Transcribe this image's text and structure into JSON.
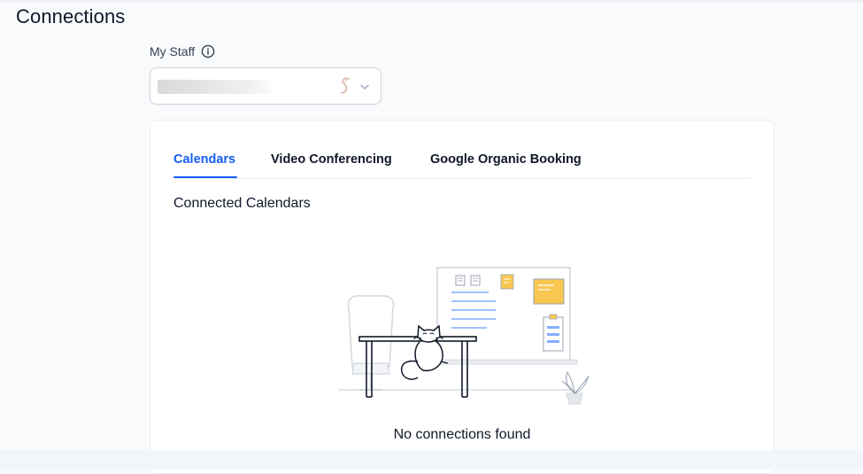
{
  "page": {
    "title": "Connections"
  },
  "staff": {
    "label": "My Staff",
    "selected_value": ""
  },
  "tabs": [
    {
      "label": "Calendars",
      "active": true
    },
    {
      "label": "Video Conferencing",
      "active": false
    },
    {
      "label": "Google Organic Booking",
      "active": false
    }
  ],
  "section": {
    "title": "Connected Calendars"
  },
  "empty_state": {
    "message": "No connections found"
  },
  "colors": {
    "accent": "#155eef",
    "text": "#101828",
    "border": "#d0d5dd",
    "sticky_note": "#f9c74f"
  },
  "icons": {
    "info": "info-icon",
    "avatar": "avatar",
    "chevron": "chevron-down-icon",
    "illustration": "empty-state-illustration"
  }
}
